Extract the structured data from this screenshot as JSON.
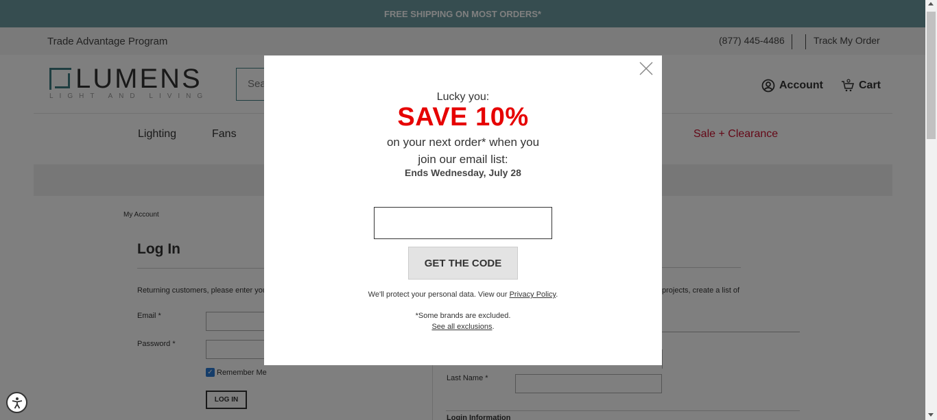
{
  "promo": {
    "text": "FREE SHIPPING ON MOST ORDERS*"
  },
  "utility": {
    "trade": "Trade Advantage Program",
    "phone": "(877) 445-4486",
    "track": "Track My Order"
  },
  "header": {
    "logo_word": "LUMENS",
    "logo_tag": "LIGHT AND LIVING",
    "search_placeholder": "Sea",
    "account": "Account",
    "cart": "Cart"
  },
  "nav": {
    "lighting": "Lighting",
    "fans": "Fans",
    "sale": "Sale + Clearance"
  },
  "page": {
    "breadcrumb": "My Account",
    "login_title": "Log In",
    "returning": "Returning customers, please enter you",
    "email_label": "Email *",
    "password_label": "Password *",
    "remember": "Remember Me",
    "login_button": "LOG IN",
    "projects": "projects, create a list of",
    "last_name_label": "Last Name *",
    "login_info": "Login Information"
  },
  "modal": {
    "lucky": "Lucky you:",
    "save": "SAVE 10%",
    "next_line1": "on your next order* when you",
    "next_line2": "join our email list:",
    "ends": "Ends Wednesday, July 28",
    "email_value": "",
    "button": "GET THE CODE",
    "protect_prefix": "We'll protect your personal data. View our ",
    "privacy": "Privacy Policy",
    "protect_suffix": ".",
    "brands": "*Some brands are excluded.",
    "exclusions": "See all exclusions",
    "exclusions_suffix": "."
  },
  "colors": {
    "promo_bar": "#6d9ba0",
    "sale_red": "#e60000",
    "brand_teal": "#3f7c83"
  }
}
